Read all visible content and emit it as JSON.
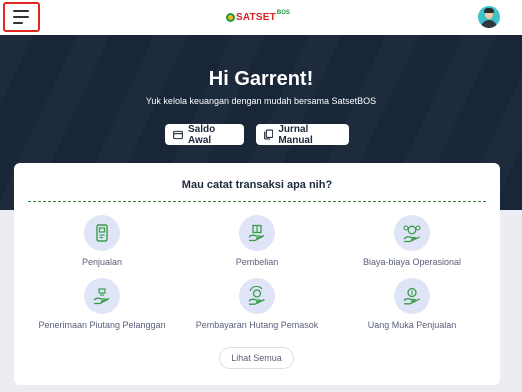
{
  "header": {
    "logo_text": "SATSET",
    "logo_sup": "BOS",
    "menu_icon": "hamburger-menu-icon",
    "avatar_icon": "user-avatar"
  },
  "hero": {
    "title": "Hi Garrent!",
    "subtitle": "Yuk kelola keuangan dengan mudah bersama SatsetBOS",
    "buttons": [
      {
        "label": "Saldo Awal",
        "icon": "wallet-icon"
      },
      {
        "label": "Jurnal Manual",
        "icon": "copy-icon"
      }
    ]
  },
  "transactions": {
    "title": "Mau catat transaksi apa nih?",
    "items": [
      {
        "label": "Penjualan",
        "icon": "sales-receipt-icon"
      },
      {
        "label": "Pembelian",
        "icon": "purchase-box-icon"
      },
      {
        "label": "Biaya-biaya Operasional",
        "icon": "operational-cost-icon"
      },
      {
        "label": "Penerimaan Piutang Pelanggan",
        "icon": "receivable-hand-icon"
      },
      {
        "label": "Pembayaran Hutang Pemasok",
        "icon": "payable-exchange-icon"
      },
      {
        "label": "Uang Muka Penjualan",
        "icon": "down-payment-hand-icon"
      }
    ],
    "see_all": "Lihat Semua"
  },
  "colors": {
    "hero_bg": "#182638",
    "accent_red": "#e0261f",
    "icon_green": "#3a9b4a",
    "icon_bg": "#dfe5f7"
  }
}
